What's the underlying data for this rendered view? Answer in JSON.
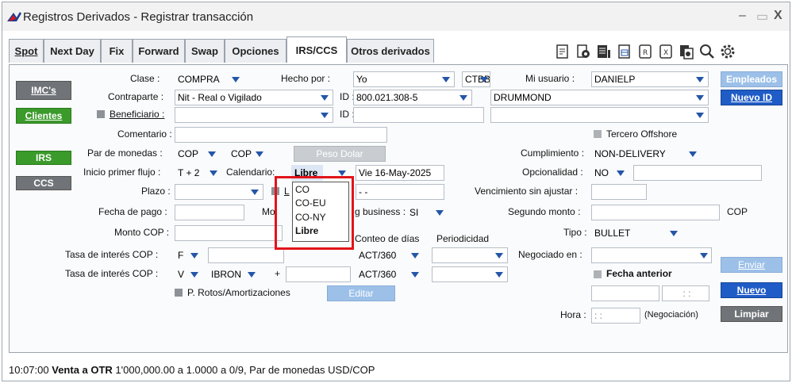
{
  "window": {
    "title": "Registros Derivados - Registrar transacción",
    "minimize": "–",
    "restore": "▭",
    "close": "X"
  },
  "tabs": [
    "Spot",
    "Next Day",
    "Fix",
    "Forward",
    "Swap",
    "Opciones",
    "IRS/CCS",
    "Otros derivados"
  ],
  "toolbar_icons": [
    "document-icon",
    "page-settings-icon",
    "page-list-icon",
    "page-sheet-icon",
    "r-box-icon",
    "x-box-icon",
    "copy-page-icon",
    "search-icon",
    "gear-icon"
  ],
  "left_buttons": {
    "imcs": "IMC's",
    "clientes": "Clientes",
    "irs": "IRS",
    "ccs": "CCS"
  },
  "form": {
    "clase_label": "Clase :",
    "clase_value": "COMPRA",
    "hecho_por_label": "Hecho por :",
    "hecho_por_value": "Yo",
    "ctbb_value": "CTBB",
    "mi_usuario_label": "Mi usuario :",
    "mi_usuario_value": "DANIELP",
    "contraparte_label": "Contraparte :",
    "contraparte_value": "Nit - Real o Vigilado",
    "id_label": "ID :",
    "id_value": "800.021.308-5",
    "drummond_value": "DRUMMOND",
    "beneficiario_label": "Beneficiario :",
    "id2_label": "ID :",
    "comentario_label": "Comentario :",
    "tercero_label": "Tercero Offshore",
    "par_label": "Par de monedas :",
    "par_value1": "COP",
    "par_value2": "COP",
    "peso_dolar": "Peso Dolar",
    "cumplimiento_label": "Cumplimiento :",
    "cumplimiento_value": "NON-DELIVERY",
    "inicio_label": "Inicio primer flujo :",
    "inicio_value": "T + 2",
    "calendario_label": "Calendario:",
    "calendario_value": "Libre",
    "fecha_value": "Vie 16-May-2025",
    "opcionalidad_label": "Opcionalidad :",
    "opcionalidad_value": "NO",
    "plazo_label": "Plazo :",
    "l_label": "L",
    "dash_value": "-   -",
    "vencimiento_label": "Vencimiento sin ajustar :",
    "fecha_pago_label": "Fecha de pago :",
    "mo_label": "Mo",
    "business_label": "g business :",
    "business_value": "SI",
    "segundo_label": "Segundo monto :",
    "segundo_currency": "COP",
    "monto_label": "Monto COP :",
    "conteo_label": "Conteo de días",
    "periodicidad_label": "Periodicidad",
    "tipo_label": "Tipo :",
    "tipo_value": "BULLET",
    "tasa1_label": "Tasa de interés COP :",
    "tasa1_value": "F",
    "conteo1_value": "ACT/360",
    "negociado_label": "Negociado en :",
    "tasa2_label": "Tasa de interés COP :",
    "tasa2_value": "V",
    "ibron_value": "IBRON",
    "plus_label": "+",
    "conteo2_value": "ACT/360",
    "fecha_anterior_label": "Fecha anterior",
    "protos_label": "P. Rotos/Amortizaciones",
    "editar": "Editar",
    "time_placeholder": ": :",
    "hora_label": "Hora :",
    "hora_value": ": :",
    "negociacion_label": "(Negociación)"
  },
  "right_buttons": {
    "empleados": "Empleados",
    "nuevo_id": "Nuevo ID",
    "enviar": "Enviar",
    "nuevo": "Nuevo",
    "limpiar": "Limpiar"
  },
  "calendar_options": [
    "CO",
    "CO-EU",
    "CO-NY",
    "Libre"
  ],
  "status": {
    "time": "10:07:00",
    "bold": "Venta a OTR",
    "rest": " 1'000,000.00 a 1.0000 a 0/9, Par de monedas USD/COP"
  },
  "colors": {
    "green": "#3a9a2a",
    "blue": "#1f5cc6",
    "gray": "#707478",
    "highlight": "#e2141b"
  }
}
